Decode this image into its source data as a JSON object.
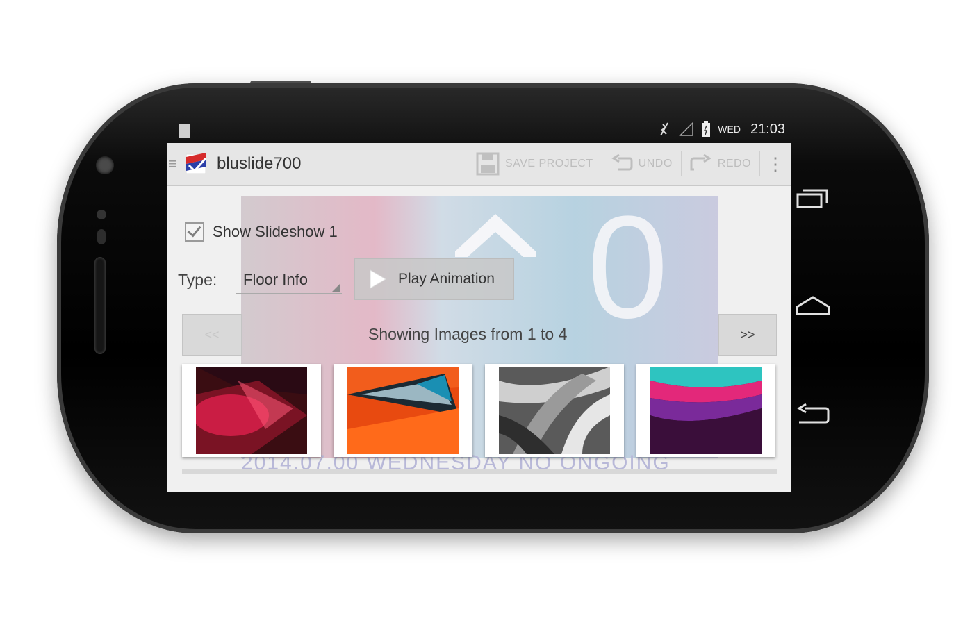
{
  "statusbar": {
    "day": "WED",
    "time": "21:03"
  },
  "app": {
    "title": "bluslide700"
  },
  "actions": {
    "save": "SAVE PROJECT",
    "undo": "UNDO",
    "redo": "REDO"
  },
  "content": {
    "show_slideshow_label": "Show Slideshow 1",
    "show_slideshow_checked": true,
    "type_label": "Type:",
    "type_value": "Floor Info",
    "play_label": "Play Animation",
    "prev_label": "<<",
    "next_label": ">>",
    "showing_text": "Showing Images from 1 to 4",
    "overlay_zero": "0",
    "overlay_bottom_text": "2014.07.00 WEDNESDAY NO ONGOING"
  },
  "thumbnails": [
    {
      "name": "red abstract"
    },
    {
      "name": "orange geometric"
    },
    {
      "name": "monochrome leaves"
    },
    {
      "name": "purple waves"
    }
  ],
  "colors": {
    "phone": "#000000",
    "actionbar": "#e6e6e6",
    "screen": "#f0f0f0"
  }
}
